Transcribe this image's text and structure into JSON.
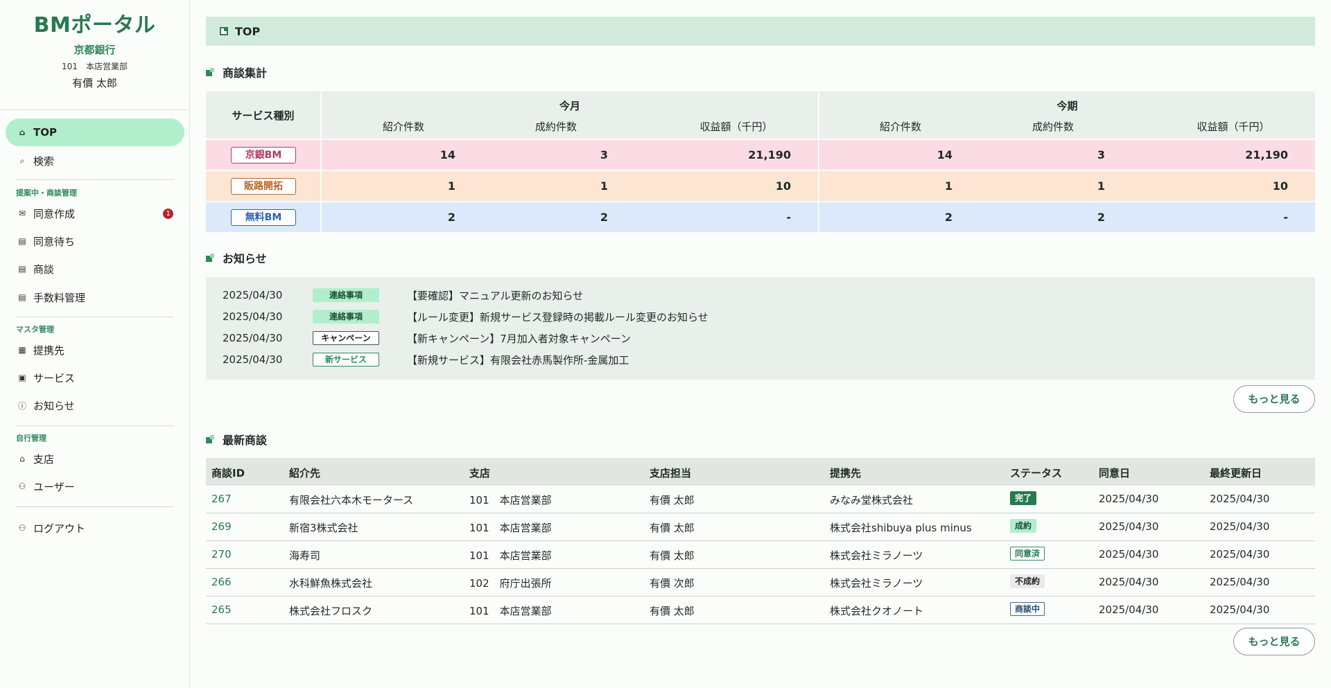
{
  "sidebar": {
    "brand": "BMポータル",
    "bank": "京都銀行",
    "branch": "101　本店営業部",
    "user": "有價 太郎",
    "top": "TOP",
    "search": "検索",
    "section_proposal": "提案中・商談管理",
    "consent_create": "同意作成",
    "consent_badge": "1",
    "consent_wait": "同意待ち",
    "deal": "商談",
    "fee": "手数料管理",
    "section_master": "マスタ管理",
    "partner": "提携先",
    "service": "サービス",
    "notice": "お知らせ",
    "section_own": "自行管理",
    "branch_menu": "支店",
    "users": "ユーザー",
    "logout": "ログアウト",
    "icons": {
      "top": "home-icon",
      "search": "search-icon",
      "consent_create": "mail-icon",
      "consent_wait": "document-icon",
      "deal": "document-icon",
      "fee": "document-icon",
      "partner": "building-icon",
      "service": "briefcase-icon",
      "notice": "info-icon",
      "branch": "bank-icon",
      "users": "users-icon",
      "logout": "users-icon"
    }
  },
  "header": {
    "title": "TOP"
  },
  "summary": {
    "title": "商談集計",
    "col_service": "サービス種別",
    "month": "今月",
    "term": "今期",
    "col_referrals": "紹介件数",
    "col_contracts": "成約件数",
    "col_revenue": "収益額（千円）",
    "rows": [
      {
        "service": "京銀BM",
        "m_ref": "14",
        "m_con": "3",
        "m_rev": "21,190",
        "t_ref": "14",
        "t_con": "3",
        "t_rev": "21,190"
      },
      {
        "service": "販路開拓",
        "m_ref": "1",
        "m_con": "1",
        "m_rev": "10",
        "t_ref": "1",
        "t_con": "1",
        "t_rev": "10"
      },
      {
        "service": "無料BM",
        "m_ref": "2",
        "m_con": "2",
        "m_rev": "-",
        "t_ref": "2",
        "t_con": "2",
        "t_rev": "-"
      }
    ]
  },
  "notices": {
    "title": "お知らせ",
    "items": [
      {
        "date": "2025/04/30",
        "tag": "連絡事項",
        "text": "【要確認】マニュアル更新のお知らせ"
      },
      {
        "date": "2025/04/30",
        "tag": "連絡事項",
        "text": "【ルール変更】新規サービス登録時の掲載ルール変更のお知らせ"
      },
      {
        "date": "2025/04/30",
        "tag": "キャンペーン",
        "text": "【新キャンペーン】7月加入者対象キャンペーン"
      },
      {
        "date": "2025/04/30",
        "tag": "新サービス",
        "text": "【新規サービス】有限会社赤馬製作所-金属加工"
      }
    ],
    "more": "もっと見る"
  },
  "deals": {
    "title": "最新商談",
    "headers": [
      "商談ID",
      "紹介先",
      "支店",
      "支店担当",
      "提携先",
      "ステータス",
      "同意日",
      "最終更新日"
    ],
    "rows": [
      {
        "id": "267",
        "client": "有限会社六本木モータース",
        "branch": "101　本店営業部",
        "staff": "有價 太郎",
        "partner": "みなみ堂株式会社",
        "status": "完了",
        "agreed": "2025/04/30",
        "updated": "2025/04/30"
      },
      {
        "id": "269",
        "client": "新宿3株式会社",
        "branch": "101　本店営業部",
        "staff": "有價 太郎",
        "partner": "株式会社shibuya plus minus",
        "status": "成約",
        "agreed": "2025/04/30",
        "updated": "2025/04/30"
      },
      {
        "id": "270",
        "client": "海寿司",
        "branch": "101　本店営業部",
        "staff": "有價 太郎",
        "partner": "株式会社ミラノーツ",
        "status": "同意済",
        "agreed": "2025/04/30",
        "updated": "2025/04/30"
      },
      {
        "id": "266",
        "client": "水科鮮魚株式会社",
        "branch": "102　府庁出張所",
        "staff": "有價 次郎",
        "partner": "株式会社ミラノーツ",
        "status": "不成約",
        "agreed": "2025/04/30",
        "updated": "2025/04/30"
      },
      {
        "id": "265",
        "client": "株式会社フロスク",
        "branch": "101　本店営業部",
        "staff": "有價 太郎",
        "partner": "株式会社クオノート",
        "status": "商談中",
        "agreed": "2025/04/30",
        "updated": "2025/04/30"
      }
    ],
    "more": "もっと見る"
  },
  "colors": {
    "brand": "#257a4f",
    "header_bg": "#d2eadb",
    "active_nav": "#b1efcc",
    "row_kyogin": "#fcdce4",
    "row_hanro": "#fde5d4",
    "row_free": "#dbe9fb"
  }
}
